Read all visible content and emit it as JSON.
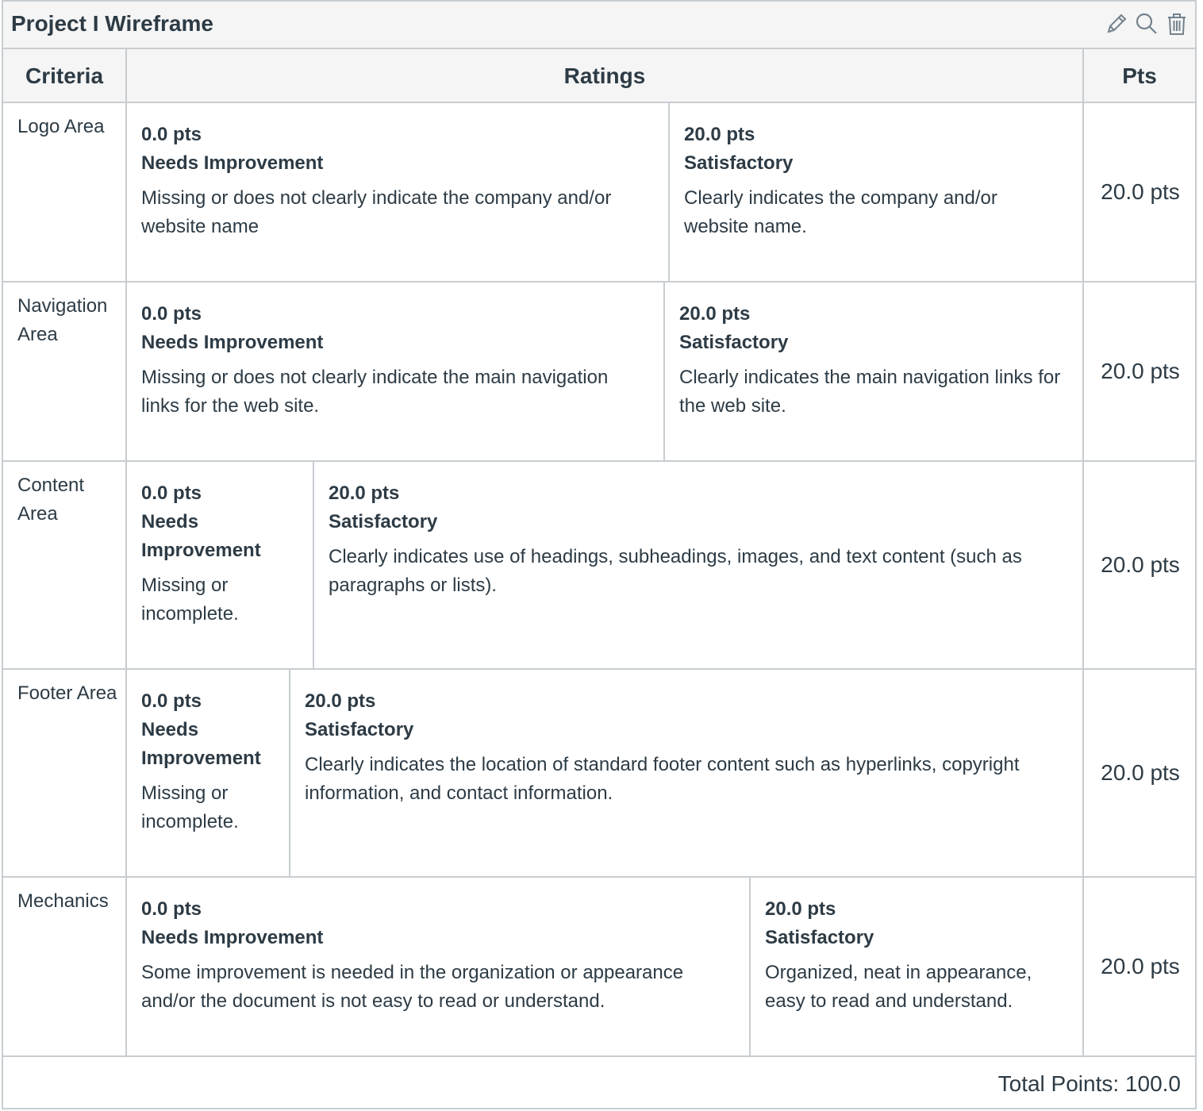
{
  "header": {
    "title": "Project I Wireframe"
  },
  "toolbar": {
    "icons": [
      "pencil-icon",
      "search-icon",
      "trash-icon"
    ]
  },
  "columns": {
    "criteria": "Criteria",
    "ratings": "Ratings",
    "pts": "Pts"
  },
  "rows": [
    {
      "criterion": "Logo Area",
      "ratings": [
        {
          "pts": "0.0 pts",
          "name": "Needs Improvement",
          "desc": "Missing or does not clearly indicate the company and/or website name"
        },
        {
          "pts": "20.0 pts",
          "name": "Satisfactory",
          "desc": "Clearly indicates the company and/or website name."
        }
      ],
      "points": "20.0 pts"
    },
    {
      "criterion": "Navigation Area",
      "ratings": [
        {
          "pts": "0.0 pts",
          "name": "Needs Improvement",
          "desc": "Missing or does not clearly indicate the main navigation links for the web site."
        },
        {
          "pts": "20.0 pts",
          "name": "Satisfactory",
          "desc": "Clearly indicates the main navigation links for the web site."
        }
      ],
      "points": "20.0 pts"
    },
    {
      "criterion": "Content Area",
      "ratings": [
        {
          "pts": "0.0 pts",
          "name": "Needs Improvement",
          "desc": "Missing or incomplete."
        },
        {
          "pts": "20.0 pts",
          "name": "Satisfactory",
          "desc": "Clearly indicates use of headings, subheadings, images, and text content (such as paragraphs or lists)."
        }
      ],
      "points": "20.0 pts"
    },
    {
      "criterion": "Footer Area",
      "ratings": [
        {
          "pts": "0.0 pts",
          "name": "Needs Improvement",
          "desc": "Missing or incomplete."
        },
        {
          "pts": "20.0 pts",
          "name": "Satisfactory",
          "desc": "Clearly indicates the location of standard footer content such as hyperlinks, copyright information, and contact information."
        }
      ],
      "points": "20.0 pts"
    },
    {
      "criterion": "Mechanics",
      "ratings": [
        {
          "pts": "0.0 pts",
          "name": "Needs Improvement",
          "desc": "Some improvement is needed in the organization or appearance and/or the document is not easy to read or understand."
        },
        {
          "pts": "20.0 pts",
          "name": "Satisfactory",
          "desc": "Organized, neat in appearance, easy to read and understand."
        }
      ],
      "points": "20.0 pts"
    }
  ],
  "footer": {
    "total": "Total Points: 100.0"
  }
}
